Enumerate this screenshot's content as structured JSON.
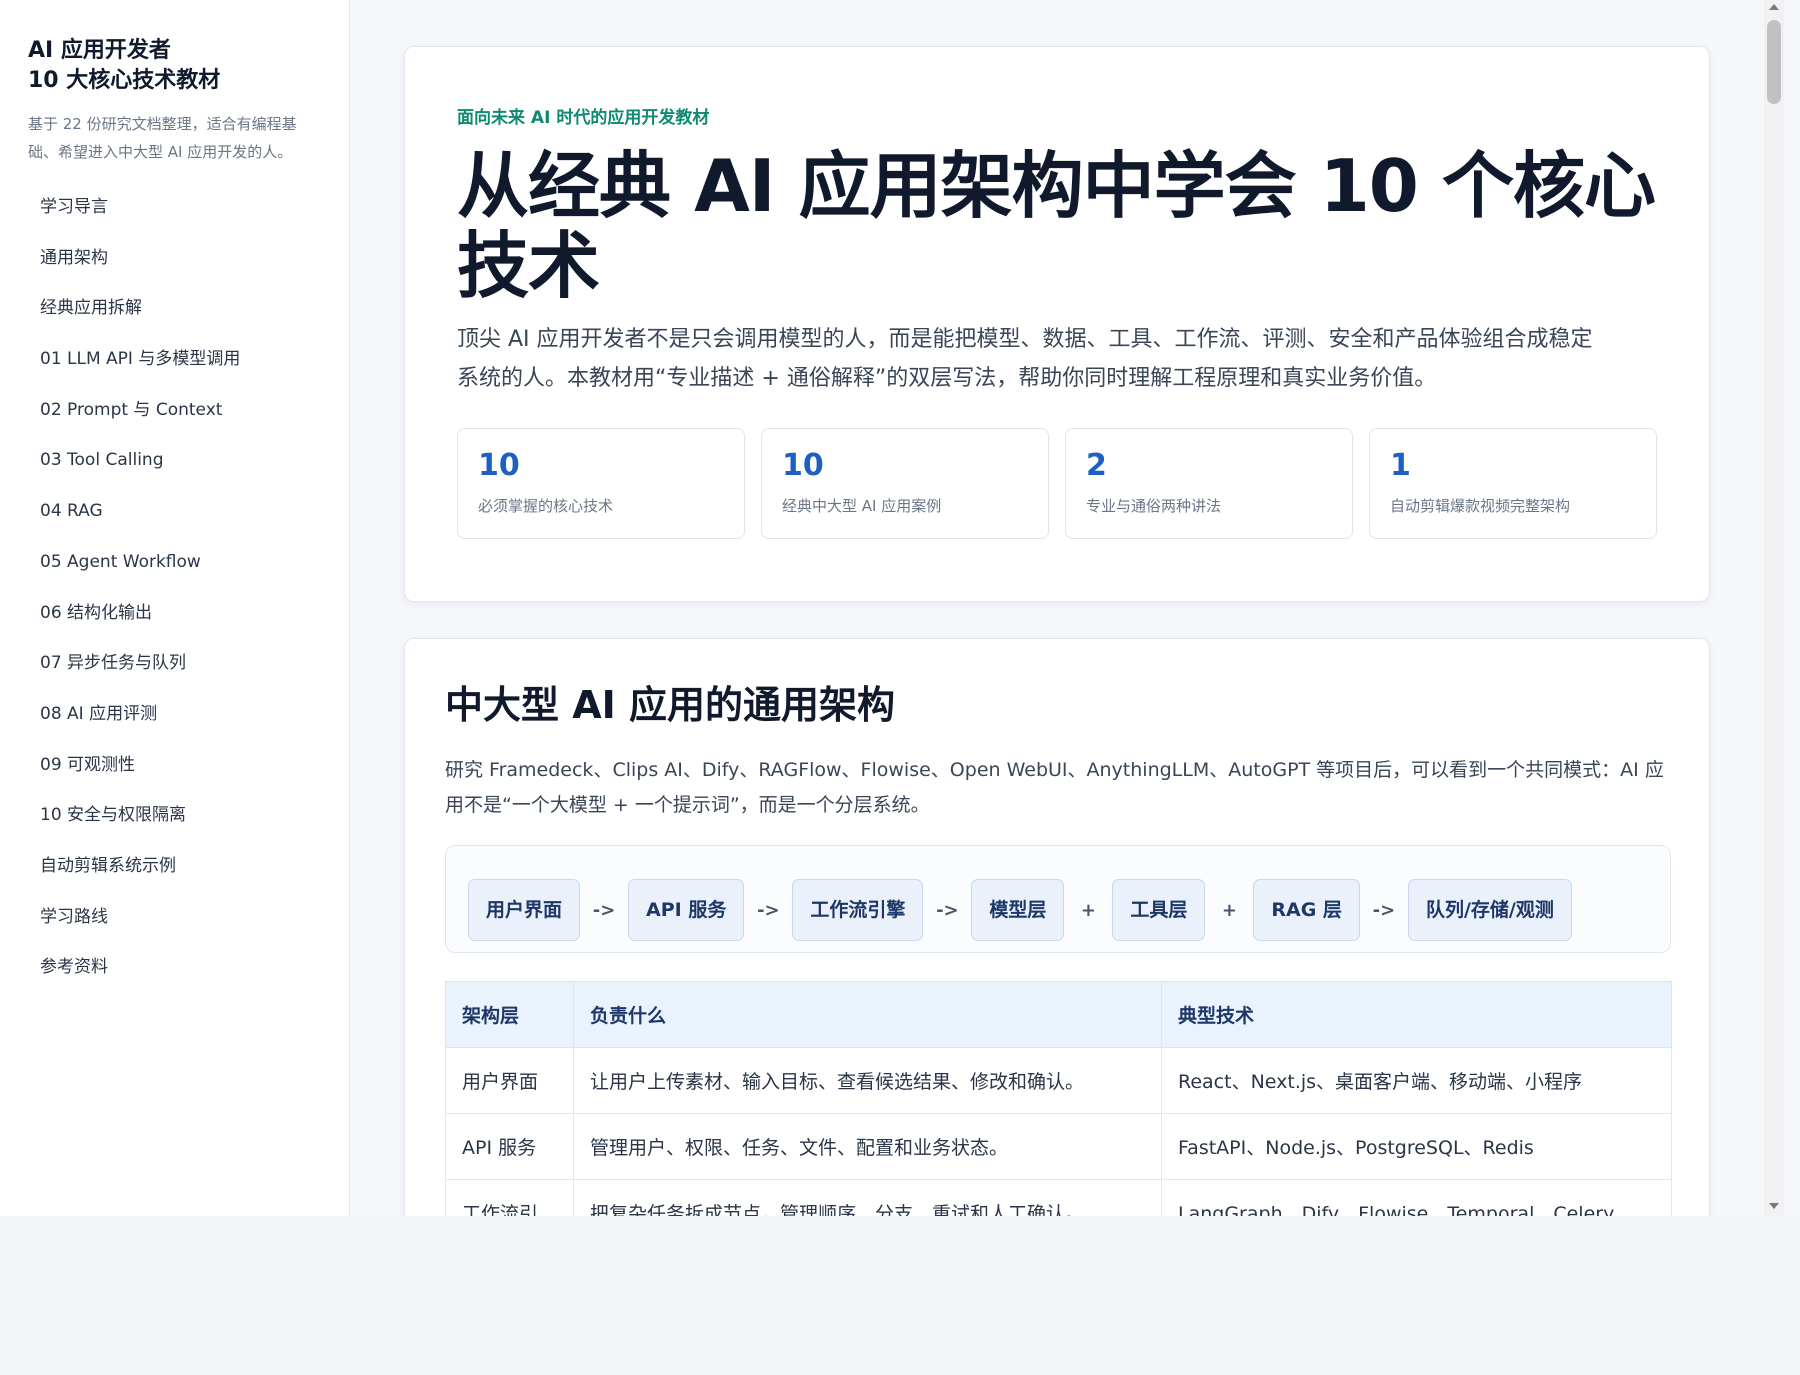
{
  "sidebar": {
    "title_line1": "AI 应用开发者",
    "title_line2": "10 大核心技术教材",
    "description": "基于 22 份研究文档整理，适合有编程基础、希望进入中大型 AI 应用开发的人。",
    "nav": [
      "学习导言",
      "通用架构",
      "经典应用拆解",
      "01 LLM API 与多模型调用",
      "02 Prompt 与 Context",
      "03 Tool Calling",
      "04 RAG",
      "05 Agent Workflow",
      "06 结构化输出",
      "07 异步任务与队列",
      "08 AI 应用评测",
      "09 可观测性",
      "10 安全与权限隔离",
      "自动剪辑系统示例",
      "学习路线",
      "参考资料"
    ]
  },
  "hero": {
    "kicker": "面向未来 AI 时代的应用开发教材",
    "title": "从经典 AI 应用架构中学会 10 个核心技术",
    "description": "顶尖 AI 应用开发者不是只会调用模型的人，而是能把模型、数据、工具、工作流、评测、安全和产品体验组合成稳定系统的人。本教材用“专业描述 + 通俗解释”的双层写法，帮助你同时理解工程原理和真实业务价值。",
    "stats": [
      {
        "value": "10",
        "label": "必须掌握的核心技术"
      },
      {
        "value": "10",
        "label": "经典中大型 AI 应用案例"
      },
      {
        "value": "2",
        "label": "专业与通俗两种讲法"
      },
      {
        "value": "1",
        "label": "自动剪辑爆款视频完整架构"
      }
    ]
  },
  "architecture": {
    "title": "中大型 AI 应用的通用架构",
    "description": "研究 Framedeck、Clips AI、Dify、RAGFlow、Flowise、Open WebUI、AnythingLLM、AutoGPT 等项目后，可以看到一个共同模式：AI 应用不是“一个大模型 + 一个提示词”，而是一个分层系统。",
    "flow": [
      {
        "label": "用户界面",
        "sep": "->"
      },
      {
        "label": "API 服务",
        "sep": "->"
      },
      {
        "label": "工作流引擎",
        "sep": "->"
      },
      {
        "label": "模型层",
        "sep": "+"
      },
      {
        "label": "工具层",
        "sep": "+"
      },
      {
        "label": "RAG 层",
        "sep": "->"
      },
      {
        "label": "队列/存储/观测",
        "sep": ""
      }
    ],
    "table": {
      "headers": [
        "架构层",
        "负责什么",
        "典型技术"
      ],
      "rows": [
        [
          "用户界面",
          "让用户上传素材、输入目标、查看候选结果、修改和确认。",
          "React、Next.js、桌面客户端、移动端、小程序"
        ],
        [
          "API 服务",
          "管理用户、权限、任务、文件、配置和业务状态。",
          "FastAPI、Node.js、PostgreSQL、Redis"
        ],
        [
          "工作流引",
          "把复杂任务拆成节点，管理顺序、分支、重试和人工确认。",
          "LangGraph、Dify、Flowise、Temporal、Celery"
        ]
      ]
    }
  }
}
